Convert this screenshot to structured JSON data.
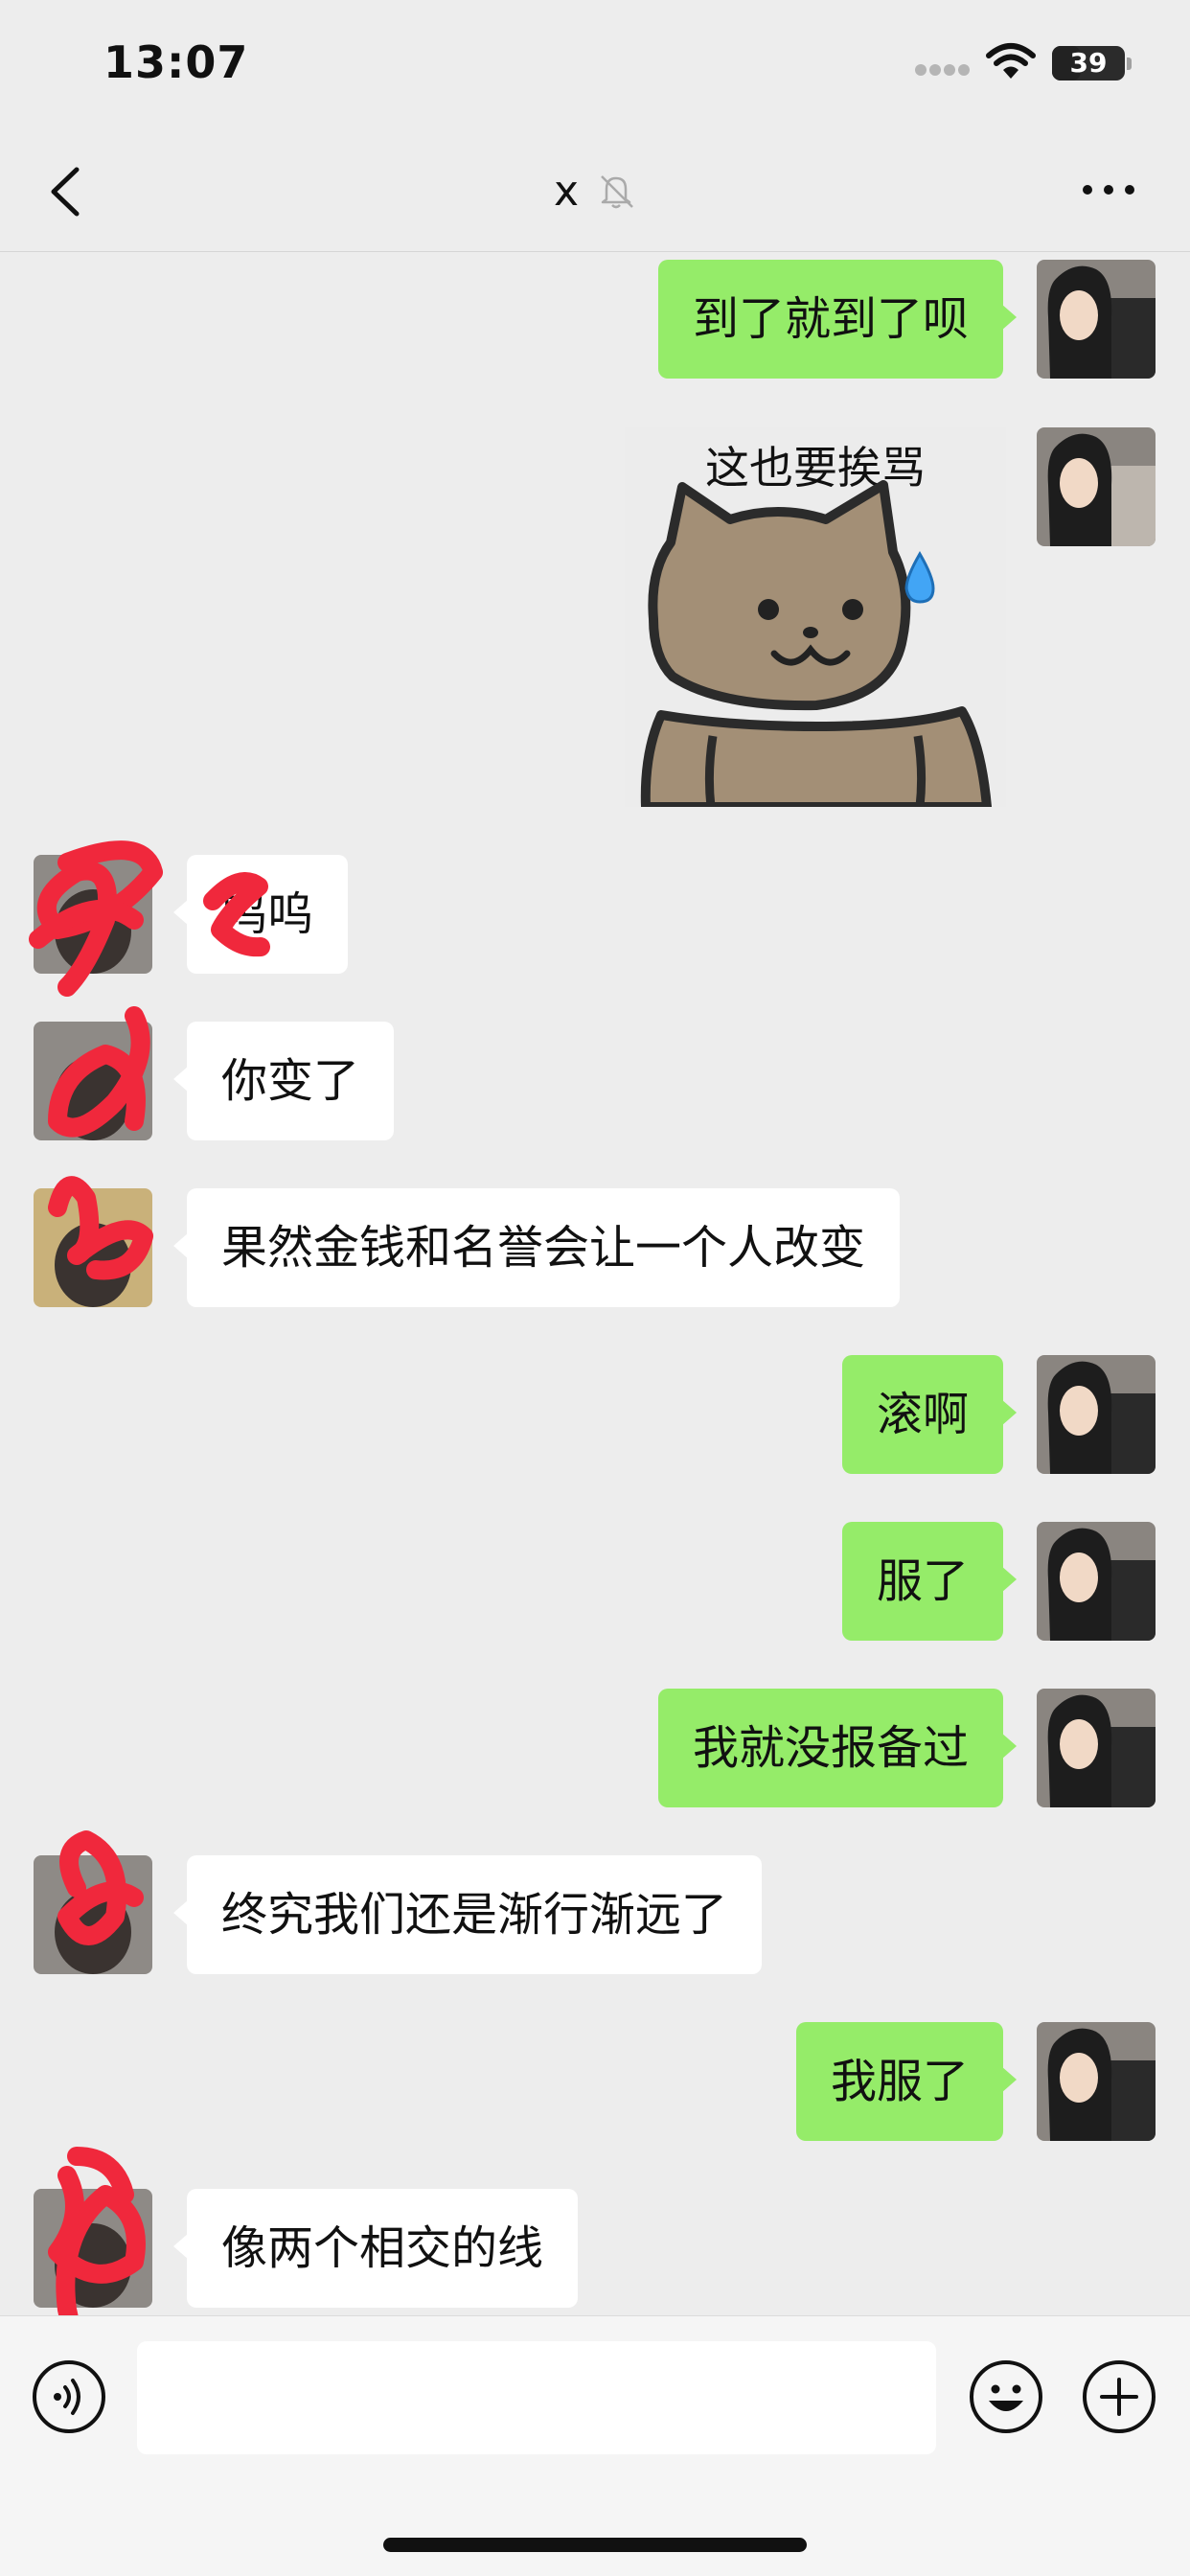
{
  "status_bar": {
    "time": "13:07",
    "battery": "39",
    "battery_level": 0.39
  },
  "nav": {
    "title": "x",
    "back_icon": "chevron-left-icon",
    "mute_icon": "bell-slash-icon",
    "more_icon": "ellipsis-icon"
  },
  "messages": [
    {
      "from": "me",
      "text": "到了就到了呗"
    },
    {
      "from": "me",
      "type": "sticker",
      "caption": "这也要挨骂",
      "sticker_icon": "sweating-cat-sticker"
    },
    {
      "from": "them",
      "text": "呜呜"
    },
    {
      "from": "them",
      "text": "你变了"
    },
    {
      "from": "them",
      "text": "果然金钱和名誉会让一个人改变"
    },
    {
      "from": "me",
      "text": "滚啊"
    },
    {
      "from": "me",
      "text": "服了"
    },
    {
      "from": "me",
      "text": "我就没报备过"
    },
    {
      "from": "them",
      "text": "终究我们还是渐行渐远了"
    },
    {
      "from": "me",
      "text": "我服了"
    },
    {
      "from": "them",
      "text": "像两个相交的线"
    }
  ],
  "input_bar": {
    "voice_icon": "voice-icon",
    "emoji_icon": "smiley-icon",
    "plus_icon": "plus-circle-icon",
    "value": ""
  },
  "colors": {
    "my_bubble": "#95ec69",
    "their_bubble": "#ffffff",
    "background": "#ededed",
    "redaction": "#f0283c"
  }
}
